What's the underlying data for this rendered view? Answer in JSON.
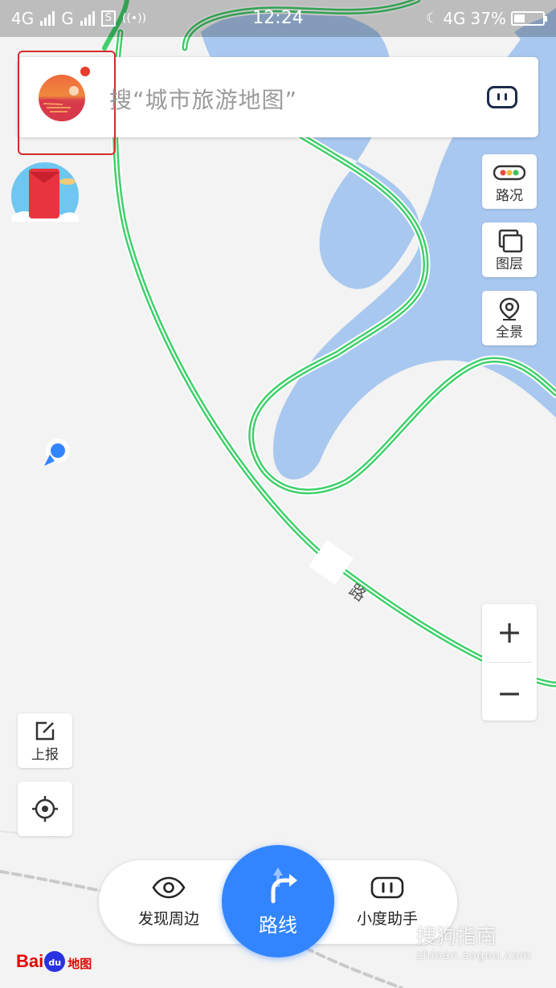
{
  "status_bar": {
    "network_left_1": "4G",
    "network_left_2": "G",
    "sim_badge": "S",
    "hotspot_icon": "hotspot-icon",
    "time": "12:24",
    "network_right": "4G",
    "battery_percent": "37%",
    "battery_level": 0.37
  },
  "search": {
    "placeholder": "搜“城市旅游地图”",
    "avatar_icon": "sunset-avatar-icon",
    "voice_icon": "xiaodu-robot-icon"
  },
  "map": {
    "road_label": "路",
    "colors": {
      "water": "#a9c8ef",
      "road": "#3fd06a",
      "land": "#f3f3f3"
    }
  },
  "right_tools": {
    "traffic": {
      "label": "路况",
      "icon": "traffic-light-icon"
    },
    "layers": {
      "label": "图层",
      "icon": "layers-icon"
    },
    "panorama": {
      "label": "全景",
      "icon": "panorama-pin-icon"
    }
  },
  "zoom": {
    "in_label": "+",
    "out_label": "−"
  },
  "left_tools": {
    "report": {
      "label": "上报",
      "icon": "edit-report-icon"
    },
    "locate": {
      "icon": "locate-crosshair-icon"
    }
  },
  "bottom_nav": {
    "discover": {
      "label": "发现周边",
      "icon": "eye-icon"
    },
    "route": {
      "label": "路线",
      "icon": "turn-right-arrow-icon"
    },
    "assistant": {
      "label": "小度助手",
      "icon": "xiaodu-robot-icon"
    }
  },
  "logo": {
    "text_latin": "Bai",
    "text_paw": "du",
    "text_cn": "地图"
  },
  "watermark": {
    "line1": "搜狗指南",
    "line2": "zhinan.sogou.com"
  },
  "accent_color": "#3385ff"
}
